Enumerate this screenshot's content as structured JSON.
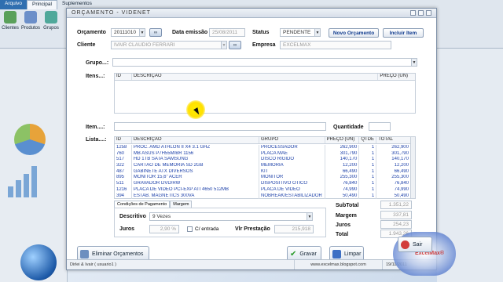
{
  "bg": {
    "tabs": [
      "Arquivo",
      "Principal",
      "Suplementos"
    ],
    "tools": [
      "Clientes",
      "Produtos",
      "Grupos"
    ]
  },
  "window": {
    "title": "ORÇAMENTO - VIDENET"
  },
  "header": {
    "orcamento_label": "Orçamento",
    "orcamento_value": "20111010",
    "data_label": "Data emissão",
    "data_value": "25/08/2011",
    "status_label": "Status",
    "status_value": "PENDENTE",
    "novo_label": "Novo Orçamento",
    "incluir_label": "Incluir Item",
    "cliente_label": "Cliente",
    "cliente_value": "IVAIR CLAUDIO FERRARI",
    "empresa_label": "Empresa",
    "empresa_value": "EXCELMAX"
  },
  "grupo_label": "Grupo...:",
  "itens": {
    "label": "Itens...:",
    "columns": [
      "ID",
      "DESCRIÇÃO",
      "PREÇO (UN)"
    ]
  },
  "item_label": "Item....:",
  "quantidade_label": "Quantidade",
  "lista": {
    "label": "Lista....:",
    "columns": [
      "ID",
      "DESCRIÇÃO",
      "GRUPO",
      "PREÇO (UN)",
      "QTDE",
      "TOTAL"
    ],
    "rows": [
      {
        "id": "1258",
        "desc": "PROC. AMD ATHLON II X4 3.1 GHZ",
        "grupo": "PROCESSADOR",
        "preco": "262,900",
        "qtde": "1",
        "total": "262,900"
      },
      {
        "id": "760",
        "desc": "MB ASUS P7H55M/BR 1156",
        "grupo": "PLACA MÃE",
        "preco": "301,790",
        "qtde": "1",
        "total": "301,790"
      },
      {
        "id": "517",
        "desc": "HD 1TB SATA SAMSUNG",
        "grupo": "DISCO RÍGIDO",
        "preco": "140,170",
        "qtde": "1",
        "total": "140,170"
      },
      {
        "id": "322",
        "desc": "CARTÃO DE MEMÓRIA SD 2GB",
        "grupo": "MEMÓRIA",
        "preco": "12,200",
        "qtde": "1",
        "total": "12,200"
      },
      {
        "id": "487",
        "desc": "GABINETE ATX DIVERSOS",
        "grupo": "KIT",
        "preco": "66,490",
        "qtde": "1",
        "total": "66,490"
      },
      {
        "id": "895",
        "desc": "MONITOR 15,6\" ACER",
        "grupo": "MONITOR",
        "preco": "255,300",
        "qtde": "1",
        "total": "255,300"
      },
      {
        "id": "511",
        "desc": "GRAVADOR DVD/RW",
        "grupo": "DISPOSITIVO ÓTICO",
        "preco": "76,840",
        "qtde": "1",
        "total": "76,840"
      },
      {
        "id": "1216",
        "desc": "PLACA DE VIDEO PCI-EXP ATI 4650 512MB",
        "grupo": "PLACA DE VÍDEO",
        "preco": "74,990",
        "qtde": "1",
        "total": "74,990"
      },
      {
        "id": "394",
        "desc": "ESTAB. MAGNETICS 300VA",
        "grupo": "NOBREAK/ESTABILIZADOR",
        "preco": "50,490",
        "qtde": "1",
        "total": "50,490"
      }
    ]
  },
  "payment": {
    "tab1": "Condições de Pagamento",
    "tab2": "Margem",
    "descritivo_label": "Descritivo",
    "descritivo_value": "9 Vezes",
    "juros_label": "Juros",
    "juros_value": "2,90 %",
    "entrada_label": "C/ entrada",
    "prestacao_label": "Vlr Prestação",
    "prestacao_value": "215,918"
  },
  "totals": {
    "subtotal_label": "SubTotal",
    "subtotal_value": "1.351,22",
    "margem_label": "Margem",
    "margem_value": "337,81",
    "juros_label": "Juros",
    "juros_value": "254,23",
    "total_label": "Total",
    "total_value": "1.943,26"
  },
  "buttons": {
    "eliminar": "Eliminar Orçamentos",
    "gravar": "Gravar",
    "limpar": "Limpar",
    "sair": "Sair"
  },
  "status": {
    "user": "Dirlei & Ivair ( usuario1 )",
    "site": "www.excelmax.blogspot.com",
    "date": "19/11/2011"
  },
  "logo_text": "ExcelMax®"
}
